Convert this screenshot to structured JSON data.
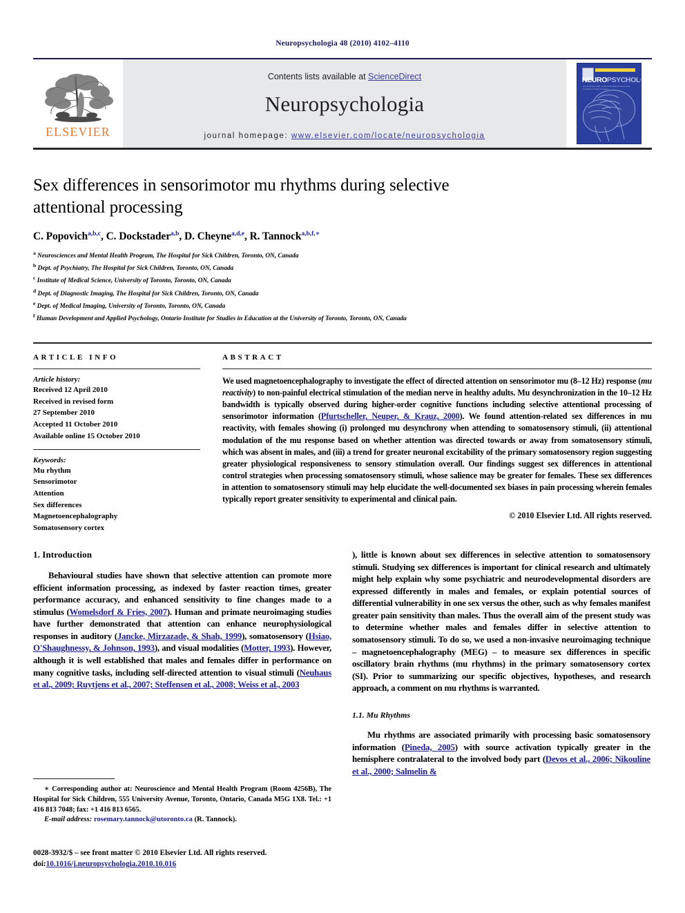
{
  "running_head": "Neuropsychologia 48 (2010) 4102–4110",
  "masthead": {
    "contents_prefix": "Contents lists available at ",
    "sciencedirect": "ScienceDirect",
    "journal_name": "Neuropsychologia",
    "homepage_prefix": "journal homepage: ",
    "homepage_url": "www.elsevier.com/locate/neuropsychologia",
    "publisher_wordmark": "ELSEVIER",
    "cover": {
      "title_main": "NEURO",
      "title_rest": "PSYCHOLOGIA",
      "subtitle": "An International Journal in Behavioural and Cognitive Neuroscience"
    },
    "colors": {
      "band_bg": "#e7e8ea",
      "link": "#3b3b9e",
      "elsevier_orange": "#E8762C",
      "cover_blue": "#2b3f9e",
      "rule_dark": "#231f20"
    }
  },
  "article": {
    "title": "Sex differences in sensorimotor mu rhythms during selective attentional processing",
    "authors": [
      {
        "name": "C. Popovich",
        "sup": "a,b,c",
        "sep": ", "
      },
      {
        "name": "C. Dockstader",
        "sup": "a,b",
        "sep": ", "
      },
      {
        "name": "D. Cheyne",
        "sup": "a,d,e",
        "sep": ", "
      },
      {
        "name": "R. Tannock",
        "sup": "a,b,f,",
        "sep": ""
      }
    ],
    "corresponding_marker": "∗",
    "affiliations": [
      {
        "mark": "a",
        "text": "Neurosciences and Mental Health Program, The Hospital for Sick Children, Toronto, ON, Canada"
      },
      {
        "mark": "b",
        "text": "Dept. of Psychiatry, The Hospital for Sick Children, Toronto, ON, Canada"
      },
      {
        "mark": "c",
        "text": "Institute of Medical Science, University of Toronto, Toronto, ON, Canada"
      },
      {
        "mark": "d",
        "text": "Dept. of Diagnostic Imaging, The Hospital for Sick Children, Toronto, ON, Canada"
      },
      {
        "mark": "e",
        "text": "Dept. of Medical Imaging, University of Toronto, Toronto, ON, Canada"
      },
      {
        "mark": "f",
        "text": "Human Development and Applied Psychology, Ontario Institute for Studies in Education at the University of Toronto, Toronto, ON, Canada"
      }
    ]
  },
  "article_info": {
    "label": "ARTICLE INFO",
    "history_heading": "Article history:",
    "history": [
      "Received 12 April 2010",
      "Received in revised form",
      "27 September 2010",
      "Accepted 11 October 2010",
      "Available online 15 October 2010"
    ],
    "keywords_heading": "Keywords:",
    "keywords": [
      "Mu rhythm",
      "Sensorimotor",
      "Attention",
      "Sex differences",
      "Magnetoencephalography",
      "Somatosensory cortex"
    ]
  },
  "abstract": {
    "label": "ABSTRACT",
    "part1": "We used magnetoencephalography to investigate the effect of directed attention on sensorimotor mu (8–12 Hz) response (",
    "italic1": "mu reactivity",
    "part2": ") to non-painful electrical stimulation of the median nerve in healthy adults. Mu desynchronization in the 10–12 Hz bandwidth is typically observed during higher-order cognitive functions including selective attentional processing of sensorimotor information (",
    "citation1": "Pfurtscheller, Neuper, & Krauz, 2000",
    "part3": "). We found attention-related sex differences in mu reactivity, with females showing (i) prolonged mu desynchrony when attending to somatosensory stimuli, (ii) attentional modulation of the mu response based on whether attention was directed towards or away from somatosensory stimuli, which was absent in males, and (iii) a trend for greater neuronal excitability of the primary somatosensory region suggesting greater physiological responsiveness to sensory stimulation overall. Our findings suggest sex differences in attentional control strategies when processing somatosensory stimuli, whose salience may be greater for females. These sex differences in attention to somatosensory stimuli may help elucidate the well-documented sex biases in pain processing wherein females typically report greater sensitivity to experimental and clinical pain.",
    "copyright": "© 2010 Elsevier Ltd. All rights reserved."
  },
  "body": {
    "section1_title": "1.  Introduction",
    "para1_a": "Behavioural studies have shown that selective attention can promote more efficient information processing, as indexed by faster reaction times, greater performance accuracy, and enhanced sensitivity to fine changes made to a stimulus (",
    "para1_cite1": "Womelsdorf & Fries, 2007",
    "para1_b": "). Human and primate neuroimaging studies have further demonstrated that attention can enhance neurophysiological responses in auditory (",
    "para1_cite2": "Jancke, Mirzazade, & Shah, 1999",
    "para1_c": "), somatosensory (",
    "para1_cite3": "Hsiao, O'Shaughnessy, & Johnson, 1993",
    "para1_d": "), and visual modalities (",
    "para1_cite4": "Motter, 1993",
    "para1_e": "). However, although it is well established that males and females differ in performance on many cognitive tasks, including self-directed attention to visual stimuli (",
    "para1_cite5": "Neuhaus et al., 2009; Ruytjens et al., 2007; Steffensen et al., 2008; Weiss et al., 2003",
    "para1_f": "), little is known about sex differences in selective attention to somatosensory stimuli. Studying sex differences is important for clinical research and ultimately might help explain why some psychiatric and neurodevelopmental disorders are expressed differently in males and females, or explain potential sources of differential vulnerability in one sex versus the other, such as why females manifest greater pain sensitivity than males. Thus the overall aim of the present study was to determine whether males and females differ in selective attention to somatosensory stimuli. To do so, we used a non-invasive neuroimaging technique – magnetoencephalography (MEG) – to measure sex differences in specific oscillatory brain rhythms (mu rhythms) in the primary somatosensory cortex (SI). Prior to summarizing our specific objectives, hypotheses, and research approach, a comment on mu rhythms is warranted.",
    "subsection_title": "1.1.  Mu Rhythms",
    "para2_a": "Mu rhythms are associated primarily with processing basic somatosensory information (",
    "para2_cite1": "Pineda, 2005",
    "para2_b": ") with source activation typically greater in the hemisphere contralateral to the involved body part (",
    "para2_cite2": "Devos et al., 2006; Nikouline et al., 2000; Salmelin &"
  },
  "footnote": {
    "marker": "∗",
    "text": " Corresponding author at: Neuroscience and Mental Health Program (Room 4256B), The Hospital for Sick Children, 555 University Avenue, Toronto, Ontario, Canada M5G 1X8. Tel.: +1 416 813 7048; fax: +1 416 813 6565.",
    "email_label": "E-mail address:",
    "email": "rosemary.tannock@utoronto.ca",
    "email_suffix": " (R. Tannock)."
  },
  "imprint": {
    "line1": "0028-3932/$ – see front matter © 2010 Elsevier Ltd. All rights reserved.",
    "doi_prefix": "doi:",
    "doi": "10.1016/j.neuropsychologia.2010.10.016"
  }
}
